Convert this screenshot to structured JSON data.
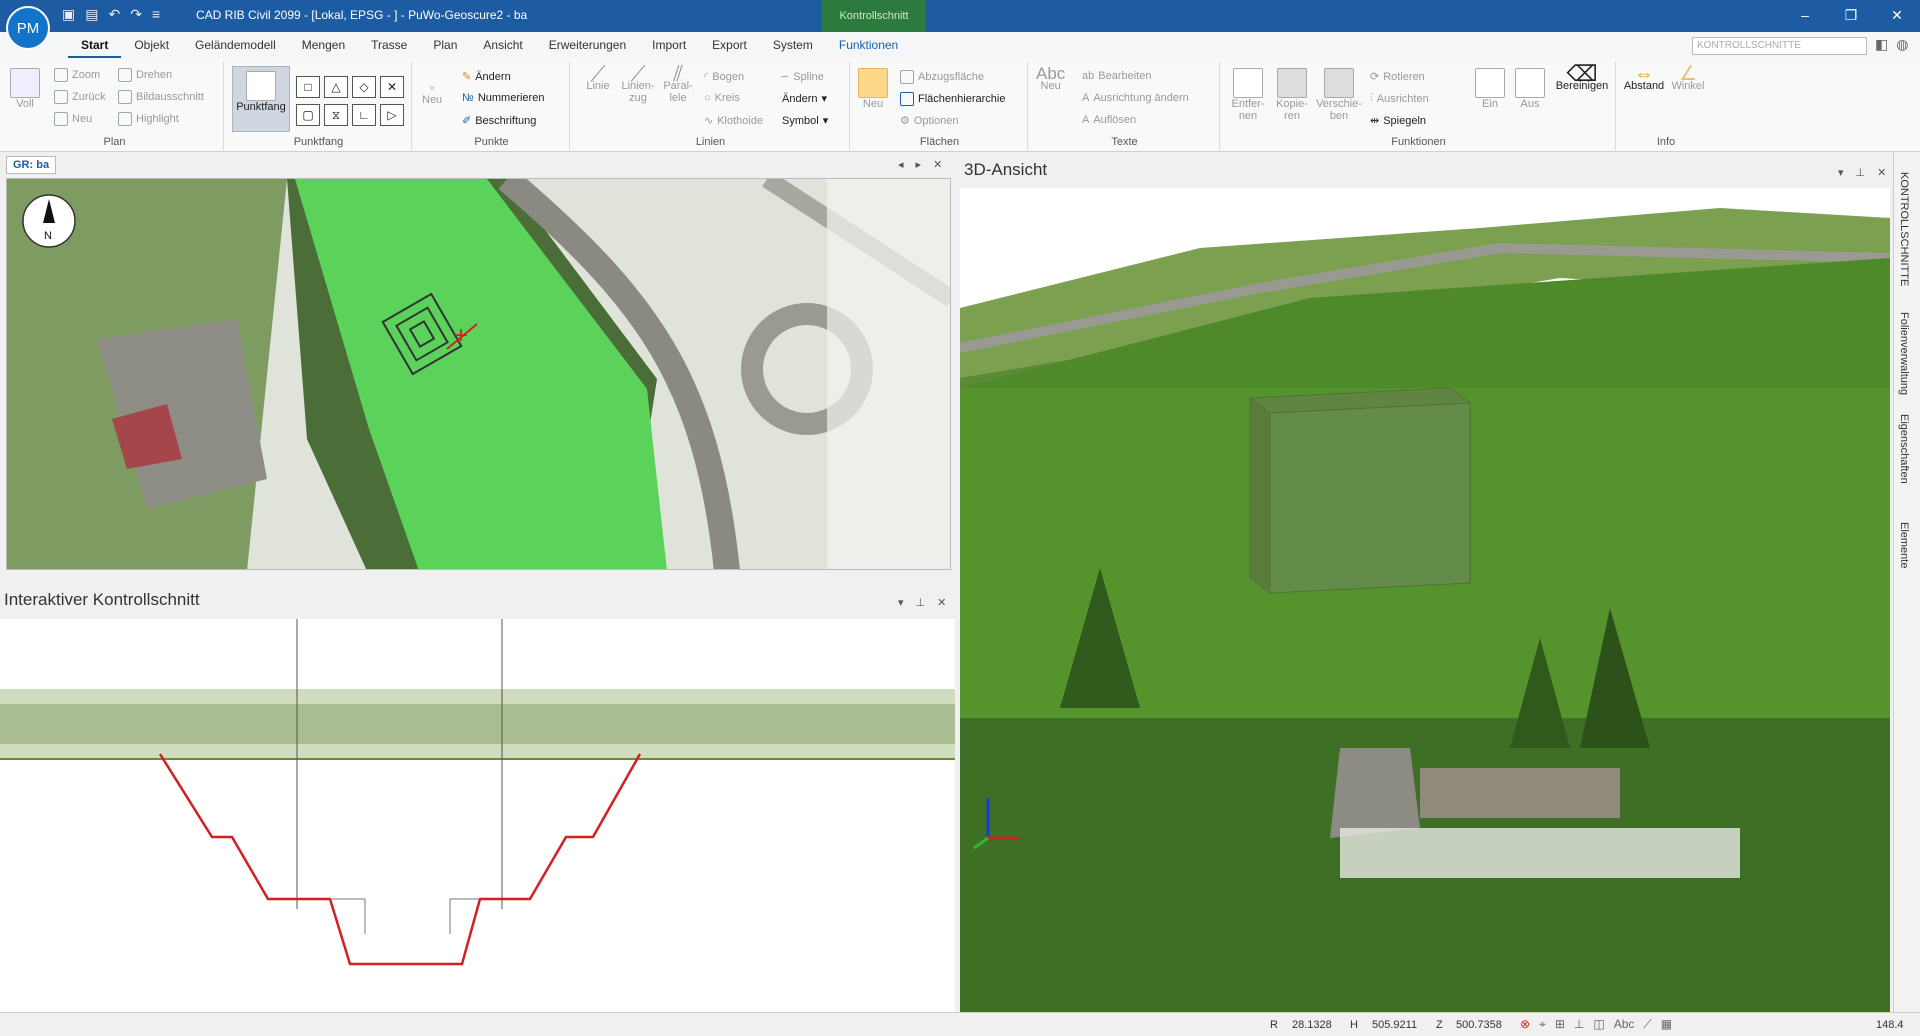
{
  "titlebar": {
    "avatar": "PM",
    "title": "CAD RIB Civil 2099 - [Lokal, EPSG - ] - PuWo-Geoscure2 - ba",
    "context_tab": "Kontrollschnitt",
    "minimize": "–",
    "restore": "❐",
    "close": "✕"
  },
  "ribbon_tabs": [
    "Start",
    "Objekt",
    "Geländemodell",
    "Mengen",
    "Trasse",
    "Plan",
    "Ansicht",
    "Erweiterungen",
    "Import",
    "Export",
    "System",
    "Funktionen"
  ],
  "ribbon_search": "KONTROLLSCHNITTE",
  "groups": {
    "plan": {
      "label": "Plan",
      "voll": "Voll",
      "zoom": "Zoom",
      "zurueck": "Zurück",
      "neu": "Neu",
      "drehen": "Drehen",
      "bildausschnitt": "Bildausschnitt",
      "highlight": "Highlight"
    },
    "punktfang": {
      "label": "Punktfang",
      "button": "Punktfang"
    },
    "punkte": {
      "label": "Punkte",
      "neu": "Neu",
      "aendern": "Ändern",
      "nummerieren": "Nummerieren",
      "beschriftung": "Beschriftung"
    },
    "linien": {
      "label": "Linien",
      "linie": "Linie",
      "linienzug": "Linien-zug",
      "parallele": "Paral-lele",
      "bogen": "Bogen",
      "kreis": "Kreis",
      "klothoide": "Klothoide",
      "spline": "Spline",
      "aendern": "Ändern",
      "symbol": "Symbol"
    },
    "flaechen": {
      "label": "Flächen",
      "neu": "Neu",
      "abzugsflaeche": "Abzugsfläche",
      "flaechenhierarchie": "Flächenhierarchie",
      "optionen": "Optionen"
    },
    "texte": {
      "label": "Texte",
      "neu": "Neu",
      "bearbeiten": "Bearbeiten",
      "ausrichtung": "Ausrichtung ändern",
      "aufloesen": "Auflösen"
    },
    "funktionen": {
      "label": "Funktionen",
      "entfernen": "Entfer-nen",
      "kopieren": "Kopie-ren",
      "verschieben": "Verschie-ben",
      "rotieren": "Rotieren",
      "ausrichten": "Ausrichten",
      "spiegeln": "Spiegeln",
      "ein": "Ein",
      "aus": "Aus",
      "bereinigen": "Bereinigen"
    },
    "info": {
      "label": "Info",
      "abstand": "Abstand",
      "winkel": "Winkel"
    }
  },
  "panels": {
    "plan_tab": "GR: ba",
    "view3d_title": "3D-Ansicht",
    "section_title": "Interaktiver Kontrollschnitt"
  },
  "sidebar": [
    "KONTROLLSCHNITTE",
    "Folienverwaltung",
    "Eigenschaften",
    "Elemente"
  ],
  "status": {
    "r_label": "R",
    "r_value": "28.1328",
    "h_label": "H",
    "h_value": "505.9211",
    "z_label": "Z",
    "z_value": "500.7358",
    "zoom": "148.4"
  },
  "colors": {
    "title_bar": "#1d5ba3",
    "context": "#2c7a3d",
    "area": "#5bd35b",
    "profile": "#d22020"
  }
}
